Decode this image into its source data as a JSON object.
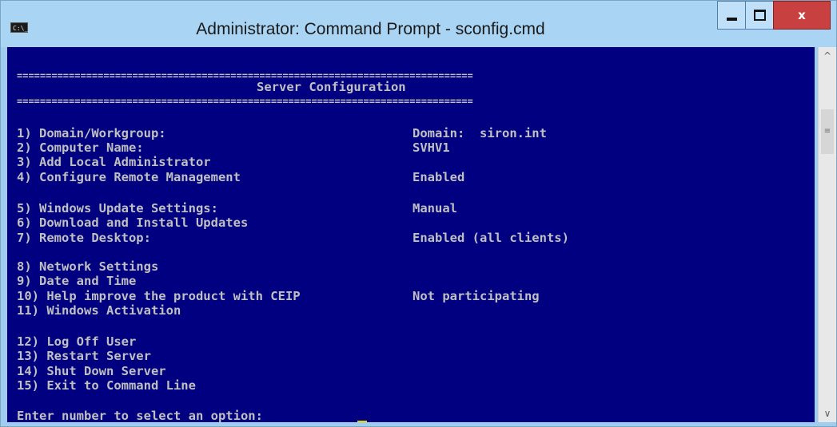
{
  "window": {
    "title": "Administrator: Command Prompt - sconfig.cmd",
    "app_icon_text": "C:\\_",
    "close_label": "x"
  },
  "console": {
    "separator": "===============================================================================",
    "header": "Server Configuration",
    "options": [
      {
        "label": "1) Domain/Workgroup:",
        "value": "Domain:  siron.int"
      },
      {
        "label": "2) Computer Name:",
        "value": "SVHV1"
      },
      {
        "label": "3) Add Local Administrator",
        "value": ""
      },
      {
        "label": "4) Configure Remote Management",
        "value": "Enabled"
      },
      {
        "label": "5) Windows Update Settings:",
        "value": "Manual"
      },
      {
        "label": "6) Download and Install Updates",
        "value": ""
      },
      {
        "label": "7) Remote Desktop:",
        "value": "Enabled (all clients)"
      },
      {
        "label": "8) Network Settings",
        "value": ""
      },
      {
        "label": "9) Date and Time",
        "value": ""
      },
      {
        "label": "10) Help improve the product with CEIP",
        "value": "Not participating"
      },
      {
        "label": "11) Windows Activation",
        "value": ""
      },
      {
        "label": "12) Log Off User",
        "value": ""
      },
      {
        "label": "13) Restart Server",
        "value": ""
      },
      {
        "label": "14) Shut Down Server",
        "value": ""
      },
      {
        "label": "15) Exit to Command Line",
        "value": ""
      }
    ],
    "prompt": "Enter number to select an option: "
  },
  "colors": {
    "console_bg": "#000080",
    "console_text": "#c0c0c0",
    "cursor": "#e8d400",
    "close_button": "#c84040"
  },
  "icons": {
    "scroll_up": "chevron-up-icon",
    "scroll_down": "chevron-down-icon",
    "scroll_grip": "grip-icon"
  }
}
